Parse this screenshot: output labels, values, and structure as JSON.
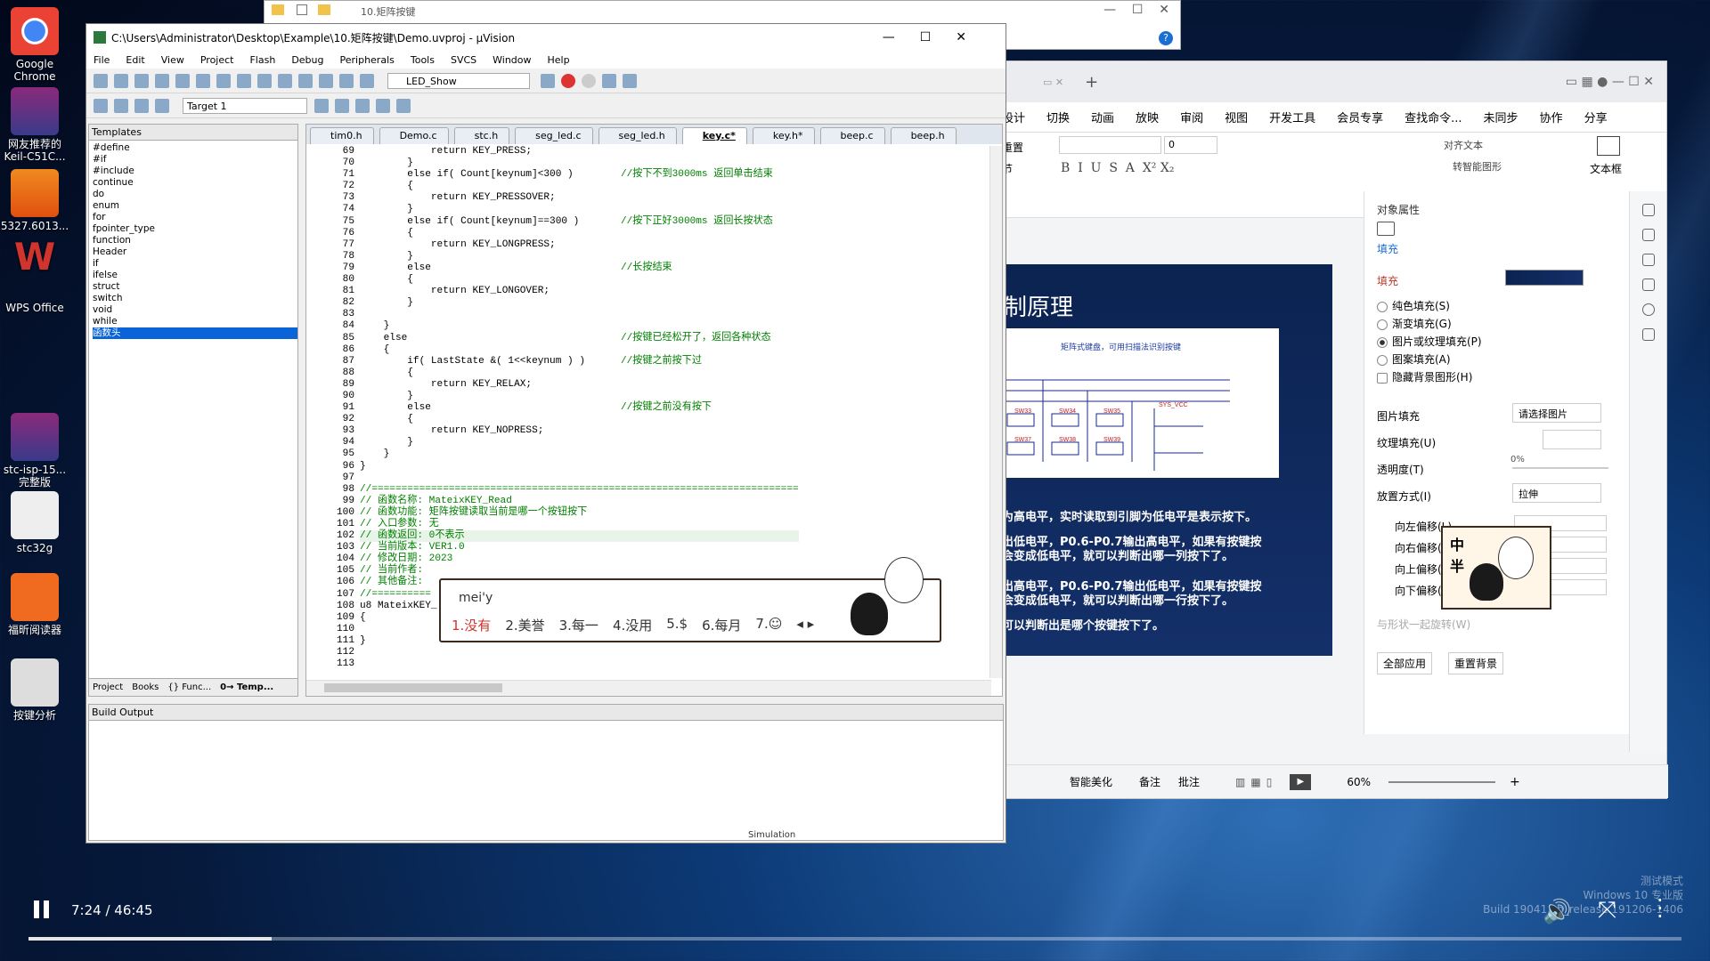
{
  "desktop_icons": [
    {
      "label": "Google\nChrome",
      "icon": "chrome-icon"
    },
    {
      "label": "网友推荐的\nKeil-C51C...",
      "icon": "winrar-icon"
    },
    {
      "label": "5327.6013...",
      "icon": "pdf-icon"
    },
    {
      "label": "WPS Office",
      "icon": "wps-icon"
    },
    {
      "label": "stc-isp-15...\n完整版",
      "icon": "winrar-icon"
    },
    {
      "label": "stc32g",
      "icon": "document-icon"
    },
    {
      "label": "福昕阅读器",
      "icon": "foxit-icon"
    },
    {
      "label": "按键分析",
      "icon": "file-icon"
    }
  ],
  "explorer": {
    "path": "10.矩阵按键"
  },
  "wps": {
    "menu": [
      "设计",
      "切换",
      "动画",
      "放映",
      "审阅",
      "视图",
      "开发工具",
      "会员专享",
      "查找命令...",
      "未同步",
      "协作",
      "分享"
    ],
    "toolbar": {
      "reset": "重置",
      "section": "节",
      "textbox": "文本框",
      "font_size": "0",
      "align": "对齐文本",
      "smartart": "转智能图形"
    },
    "slide": {
      "title": "制原理",
      "lines": [
        "为高电平，实时读取到引脚为低电平是表示按下。",
        "出低电平，P0.6-P0.7输出高电平，如果有按键按",
        "会变成低电平，就可以判断出哪一列按下了。",
        "出高电平，P0.6-P0.7输出低电平，如果有按键按",
        "会变成低电平，就可以判断出哪一行按下了。",
        "可以判断出是哪个按键按下了。"
      ],
      "pic_caption": "矩阵式键盘，可用扫描法识别按键"
    },
    "panel": {
      "title": "对象属性",
      "tab": "填充",
      "section": "填充",
      "options": [
        "纯色填充(S)",
        "渐变填充(G)",
        "图片或纹理填充(P)",
        "图案填充(A)",
        "隐藏背景图形(H)"
      ],
      "selected_option": 2,
      "pic_fill_label": "图片填充",
      "pic_fill_value": "请选择图片",
      "texture_label": "纹理填充(U)",
      "opacity_label": "透明度(T)",
      "opacity_value": "0%",
      "placement_label": "放置方式(I)",
      "placement_value": "拉伸",
      "offsets": [
        "向左偏移(L)",
        "向右偏移(R)",
        "向上偏移(O)",
        "向下偏移(M)"
      ],
      "rotate_label": "与形状一起旋转(W)",
      "apply_all": "全部应用",
      "reset_bg": "重置背景"
    },
    "status": {
      "beautify": "智能美化",
      "notes": "备注",
      "comments": "批注",
      "zoom": "60%"
    }
  },
  "uvision": {
    "title": "C:\\Users\\Administrator\\Desktop\\Example\\10.矩阵按键\\Demo.uvproj - µVision",
    "menu": [
      "File",
      "Edit",
      "View",
      "Project",
      "Flash",
      "Debug",
      "Peripherals",
      "Tools",
      "SVCS",
      "Window",
      "Help"
    ],
    "toolbar_target": "LED_Show",
    "toolbar_target2": "Target 1",
    "templates_title": "Templates",
    "templates": [
      "#define",
      "#if",
      "#include",
      "continue",
      "do",
      "enum",
      "for",
      "fpointer_type",
      "function",
      "Header",
      "if",
      "ifelse",
      "struct",
      "switch",
      "void",
      "while",
      "函数头"
    ],
    "templates_selected": 16,
    "panel_tabs": [
      "Project",
      "Books",
      "{} Func...",
      "0→ Temp..."
    ],
    "file_tabs": [
      "tim0.h",
      "Demo.c",
      "stc.h",
      "seg_led.c",
      "seg_led.h",
      "key.c*",
      "key.h*",
      "beep.c",
      "beep.h"
    ],
    "active_tab": 5,
    "line_numbers": [
      "69",
      "70",
      "71",
      "72",
      "73",
      "74",
      "75",
      "76",
      "77",
      "78",
      "79",
      "80",
      "81",
      "82",
      "83",
      "84",
      "85",
      "86",
      "87",
      "88",
      "89",
      "90",
      "91",
      "92",
      "93",
      "94",
      "95",
      "96",
      "97",
      "98",
      "99",
      "100",
      "101",
      "102",
      "103",
      "104",
      "105",
      "106",
      "107",
      "108",
      "109",
      "110",
      "111",
      "112",
      "113"
    ],
    "code_lines": [
      "            return KEY_PRESS;",
      "        }",
      "        else if( Count[keynum]<300 )        //按下不到3000ms 返回单击结束",
      "        {",
      "            return KEY_PRESSOVER;",
      "        }",
      "        else if( Count[keynum]==300 )       //按下正好3000ms 返回长按状态",
      "        {",
      "            return KEY_LONGPRESS;",
      "        }",
      "        else                                //长按结束",
      "        {",
      "            return KEY_LONGOVER;",
      "        }",
      "",
      "    }",
      "    else                                    //按键已经松开了，返回各种状态",
      "    {",
      "        if( LastState &( 1<<keynum ) )      //按键之前按下过",
      "        {",
      "            return KEY_RELAX;",
      "        }",
      "        else                                //按键之前没有按下",
      "        {",
      "            return KEY_NOPRESS;",
      "        }",
      "    }",
      "}",
      "",
      "//========================================================================",
      "// 函数名称: MateixKEY_Read",
      "// 函数功能: 矩阵按键读取当前是哪一个按钮按下",
      "// 入口参数: 无",
      "// 函数返回: 0不表示",
      "// 当前版本: VER1.0",
      "// 修改日期: 2023",
      "// 当前作者:",
      "// 其他备注:",
      "//==========",
      "u8 MateixKEY_",
      "{",
      "",
      "}",
      "",
      ""
    ],
    "output_title": "Build Output",
    "status_mode": "Simulation"
  },
  "ime": {
    "composition": "mei'y",
    "candidates": [
      "1.没有",
      "2.美誉",
      "3.每一",
      "4.没用",
      "5.$",
      "6.每月",
      "7.☺"
    ]
  },
  "video": {
    "time": "7:24 / 46:45",
    "progress": 0.147
  },
  "watermark": [
    "测试模式",
    "Windows 10 专业版",
    "Build 19041.vb_release.191206-1406"
  ],
  "colors": {
    "accent": "#0a64d8",
    "comment": "#008000",
    "ime_first": "#d0342c"
  }
}
